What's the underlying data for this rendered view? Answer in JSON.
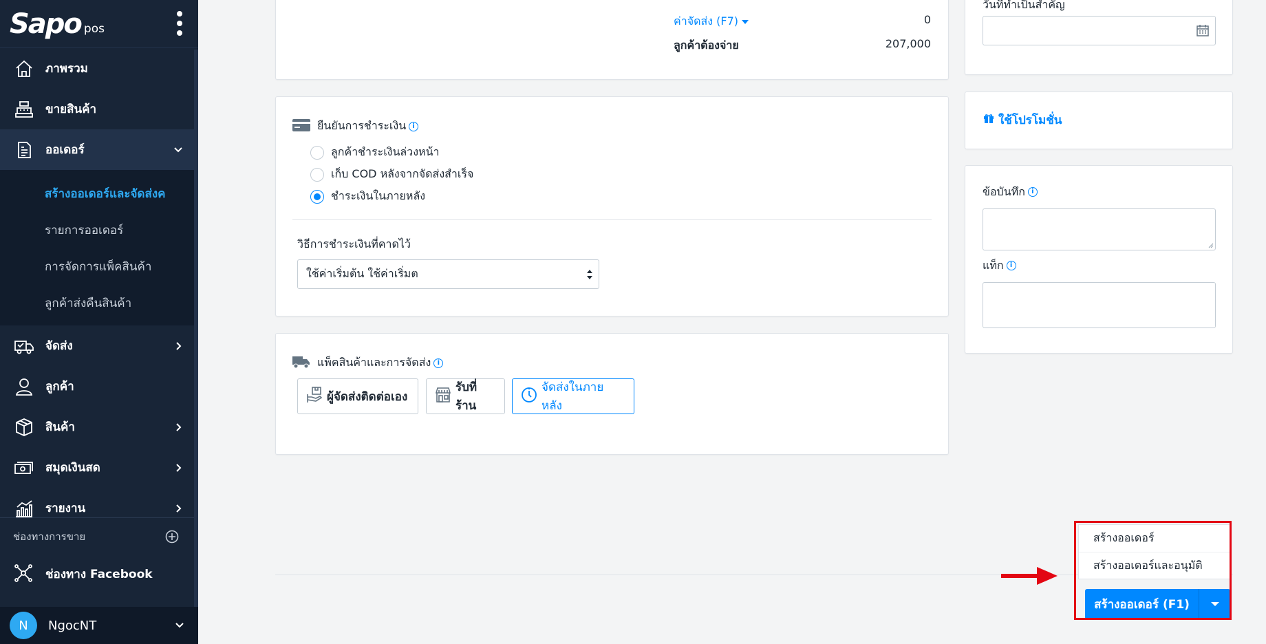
{
  "brand": {
    "logo": "Sapo",
    "suffix": "pos"
  },
  "colors": {
    "sidebar_bg": "#182537",
    "accent": "#0088ff",
    "active_sub": "#2ea9f2",
    "highlight": "#e30613"
  },
  "sidebar": {
    "items": [
      {
        "label": "ภาพรวม",
        "icon": "home-icon"
      },
      {
        "label": "ขายสินค้า",
        "icon": "cash-register-icon"
      },
      {
        "label": "ออเดอร์",
        "icon": "order-document-icon",
        "expanded": true
      },
      {
        "label": "จัดส่ง",
        "icon": "delivery-truck-icon"
      },
      {
        "label": "ลูกค้า",
        "icon": "user-icon"
      },
      {
        "label": "สินค้า",
        "icon": "box-icon"
      },
      {
        "label": "สมุดเงินสด",
        "icon": "cash-book-icon"
      },
      {
        "label": "รายงาน",
        "icon": "report-chart-icon"
      }
    ],
    "order_sub": [
      {
        "label": "สร้างออเดอร์และจัดส่งค",
        "current": true
      },
      {
        "label": "รายการออเดอร์"
      },
      {
        "label": "การจัดการแพ็คสินค้า"
      },
      {
        "label": "ลูกค้าส่งคืนสินค้า"
      }
    ],
    "channels_heading": "ช่องทางการขาย",
    "facebook_channel": "ช่องทาง Facebook",
    "user": {
      "initial": "N",
      "name": "NgocNT"
    }
  },
  "summary": {
    "shipping_fee_label": "ค่าจัดส่ง (F7)",
    "shipping_fee_value": "0",
    "customer_pays_label": "ลูกค้าต้องจ่าย",
    "customer_pays_value": "207,000"
  },
  "payment": {
    "title": "ยืนยันการชำระเงิน",
    "options": [
      {
        "label": "ลูกค้าชำระเงินล่วงหน้า",
        "checked": false
      },
      {
        "label": "เก็บ COD หลังจากจัดส่งสำเร็จ",
        "checked": false
      },
      {
        "label": "ชำระเงินในภายหลัง",
        "checked": true
      }
    ],
    "method_label": "วิธีการชำระเงินที่คาดไว้",
    "method_value": "ใช้ค่าเริ่มต้น ใช้ค่าเริ่มต"
  },
  "shipping": {
    "title": "แพ็คสินค้าและการจัดส่ง",
    "options": [
      {
        "label": "ผู้จัดส่งติดต่อเอง",
        "selected": false
      },
      {
        "label": "รับที่ร้าน",
        "selected": false
      },
      {
        "label": "จัดส่งในภายหลัง",
        "selected": true
      }
    ]
  },
  "right": {
    "date_label": "วันที่ทำเป็นสำคัญ",
    "promo": "ใช้โปรโมชั่น",
    "notes_label": "ข้อบันทึก",
    "tags_label": "แท็ก"
  },
  "actions": {
    "dropdown": [
      "สร้างออเดอร์",
      "สร้างออเดอร์และอนุมัติ"
    ],
    "create_button": "สร้างออเดอร์ (F1)"
  }
}
